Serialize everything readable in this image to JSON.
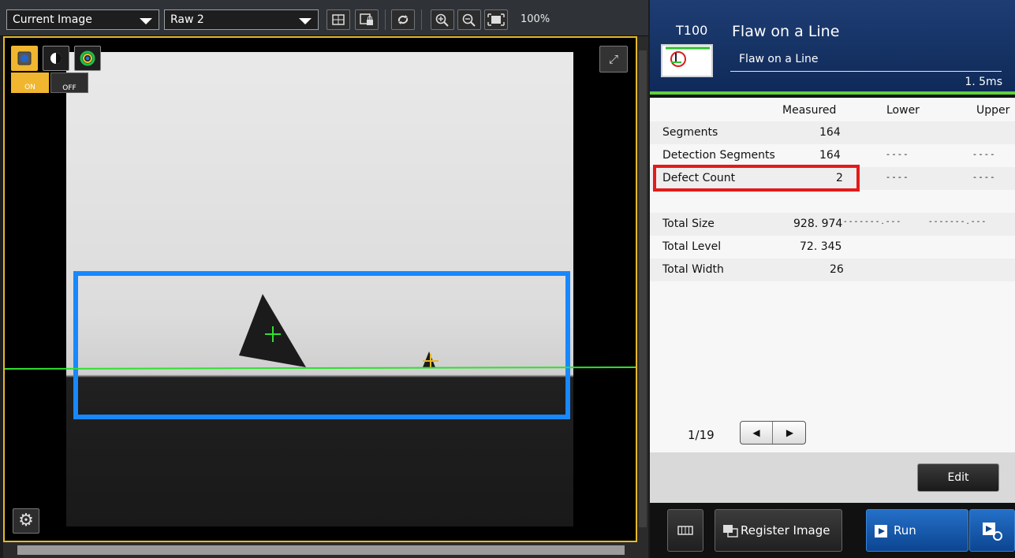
{
  "toolbar": {
    "image_source": "Current Image",
    "image_channel": "Raw 2",
    "zoom": "100%"
  },
  "image_view": {
    "display_mode_on_label": "ON",
    "display_mode_off_label": "OFF"
  },
  "tool": {
    "id": "T100",
    "name": "Flaw on a Line",
    "subtitle": "Flaw on a Line",
    "time": "1. 5ms"
  },
  "results": {
    "headers": {
      "measured": "Measured",
      "lower": "Lower",
      "upper": "Upper"
    },
    "rows": [
      {
        "label": "Segments",
        "measured": "164",
        "lower": "",
        "upper": ""
      },
      {
        "label": "Detection Segments",
        "measured": "164",
        "lower": "- - - -",
        "upper": "- - - -"
      },
      {
        "label": "Defect Count",
        "measured": "2",
        "lower": "- - - -",
        "upper": "- - - -"
      },
      {
        "label": "",
        "measured": "",
        "lower": "",
        "upper": ""
      },
      {
        "label": "Total Size",
        "measured": "928. 974",
        "lower": "- - - - - - - . - - -",
        "upper": "- - - - - - - . - - -"
      },
      {
        "label": "Total Level",
        "measured": "72. 345",
        "lower": "",
        "upper": ""
      },
      {
        "label": "Total Width",
        "measured": "26",
        "lower": "",
        "upper": ""
      }
    ]
  },
  "pager": {
    "label": "1/19"
  },
  "buttons": {
    "edit": "Edit",
    "register_image": "Register Image",
    "run": "Run"
  },
  "colors": {
    "accent_yellow": "#f0b62f",
    "roi_blue": "#1788ff",
    "line_green": "#30e030",
    "highlight_red": "#e41a1a",
    "header_blue": "#1e3d73"
  }
}
